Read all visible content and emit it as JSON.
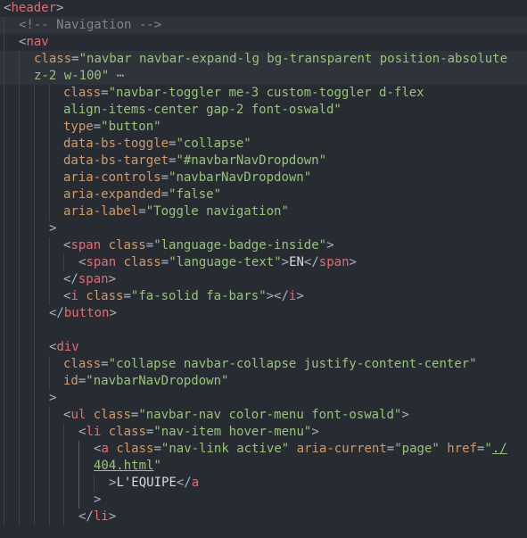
{
  "editor": {
    "language": "html",
    "colors": {
      "background": "#272c33",
      "tag": "#e06c75",
      "attribute": "#d19a66",
      "string": "#98c379",
      "comment": "#7f848e",
      "text": "#d7dae0"
    },
    "lines": [
      {
        "highlight": false,
        "tokens": [
          {
            "t": "pun",
            "v": "<"
          },
          {
            "t": "tag",
            "v": "header"
          },
          {
            "t": "pun",
            "v": ">"
          }
        ]
      },
      {
        "highlight": true,
        "tokens": [
          {
            "t": "com",
            "v": "<!-- Navigation -->"
          }
        ]
      },
      {
        "highlight": false,
        "tokens": [
          {
            "t": "pun",
            "v": "<"
          },
          {
            "t": "tag",
            "v": "nav"
          }
        ]
      },
      {
        "highlight": true,
        "tokens": [
          {
            "t": "attr",
            "v": "class"
          },
          {
            "t": "pun",
            "v": "="
          },
          {
            "t": "str",
            "v": "\"navbar navbar-expand-lg bg-transparent position-absolute"
          }
        ]
      },
      {
        "highlight": true,
        "tokens": [
          {
            "t": "str",
            "v": "z-2 w-100\""
          },
          {
            "t": "fold",
            "v": " ⋯"
          }
        ]
      },
      {
        "highlight": false,
        "tokens": [
          {
            "t": "attr",
            "v": "class"
          },
          {
            "t": "pun",
            "v": "="
          },
          {
            "t": "str",
            "v": "\"navbar-toggler me-3 custom-toggler d-flex"
          }
        ]
      },
      {
        "highlight": false,
        "tokens": [
          {
            "t": "str",
            "v": "align-items-center gap-2 font-oswald\""
          }
        ]
      },
      {
        "highlight": false,
        "tokens": [
          {
            "t": "attr",
            "v": "type"
          },
          {
            "t": "pun",
            "v": "="
          },
          {
            "t": "str",
            "v": "\"button\""
          }
        ]
      },
      {
        "highlight": false,
        "tokens": [
          {
            "t": "attr",
            "v": "data-bs-toggle"
          },
          {
            "t": "pun",
            "v": "="
          },
          {
            "t": "str",
            "v": "\"collapse\""
          }
        ]
      },
      {
        "highlight": false,
        "tokens": [
          {
            "t": "attr",
            "v": "data-bs-target"
          },
          {
            "t": "pun",
            "v": "="
          },
          {
            "t": "str",
            "v": "\"#navbarNavDropdown\""
          }
        ]
      },
      {
        "highlight": false,
        "tokens": [
          {
            "t": "attr",
            "v": "aria-controls"
          },
          {
            "t": "pun",
            "v": "="
          },
          {
            "t": "str",
            "v": "\"navbarNavDropdown\""
          }
        ]
      },
      {
        "highlight": false,
        "tokens": [
          {
            "t": "attr",
            "v": "aria-expanded"
          },
          {
            "t": "pun",
            "v": "="
          },
          {
            "t": "str",
            "v": "\"false\""
          }
        ]
      },
      {
        "highlight": false,
        "tokens": [
          {
            "t": "attr",
            "v": "aria-label"
          },
          {
            "t": "pun",
            "v": "="
          },
          {
            "t": "str",
            "v": "\"Toggle navigation\""
          }
        ]
      },
      {
        "highlight": false,
        "tokens": [
          {
            "t": "pun",
            "v": ">"
          }
        ]
      },
      {
        "highlight": false,
        "tokens": [
          {
            "t": "pun",
            "v": "<"
          },
          {
            "t": "tag",
            "v": "span"
          },
          {
            "t": "txt",
            "v": " "
          },
          {
            "t": "attr",
            "v": "class"
          },
          {
            "t": "pun",
            "v": "="
          },
          {
            "t": "str",
            "v": "\"language-badge-inside\""
          },
          {
            "t": "pun",
            "v": ">"
          }
        ]
      },
      {
        "highlight": false,
        "tokens": [
          {
            "t": "pun",
            "v": "<"
          },
          {
            "t": "tag",
            "v": "span"
          },
          {
            "t": "txt",
            "v": " "
          },
          {
            "t": "attr",
            "v": "class"
          },
          {
            "t": "pun",
            "v": "="
          },
          {
            "t": "str",
            "v": "\"language-text\""
          },
          {
            "t": "pun",
            "v": ">"
          },
          {
            "t": "txt",
            "v": "EN"
          },
          {
            "t": "pun",
            "v": "</"
          },
          {
            "t": "tag",
            "v": "span"
          },
          {
            "t": "pun",
            "v": ">"
          }
        ]
      },
      {
        "highlight": false,
        "tokens": [
          {
            "t": "pun",
            "v": "</"
          },
          {
            "t": "tag",
            "v": "span"
          },
          {
            "t": "pun",
            "v": ">"
          }
        ]
      },
      {
        "highlight": false,
        "tokens": [
          {
            "t": "pun",
            "v": "<"
          },
          {
            "t": "tag",
            "v": "i"
          },
          {
            "t": "txt",
            "v": " "
          },
          {
            "t": "attr",
            "v": "class"
          },
          {
            "t": "pun",
            "v": "="
          },
          {
            "t": "str",
            "v": "\"fa-solid fa-bars\""
          },
          {
            "t": "pun",
            "v": "></"
          },
          {
            "t": "tag",
            "v": "i"
          },
          {
            "t": "pun",
            "v": ">"
          }
        ]
      },
      {
        "highlight": false,
        "tokens": [
          {
            "t": "pun",
            "v": "</"
          },
          {
            "t": "tag",
            "v": "button"
          },
          {
            "t": "pun",
            "v": ">"
          }
        ]
      },
      {
        "highlight": false,
        "tokens": []
      },
      {
        "highlight": false,
        "tokens": [
          {
            "t": "pun",
            "v": "<"
          },
          {
            "t": "tag",
            "v": "div"
          }
        ]
      },
      {
        "highlight": false,
        "tokens": [
          {
            "t": "attr",
            "v": "class"
          },
          {
            "t": "pun",
            "v": "="
          },
          {
            "t": "str",
            "v": "\"collapse navbar-collapse justify-content-center\""
          }
        ]
      },
      {
        "highlight": false,
        "tokens": [
          {
            "t": "attr",
            "v": "id"
          },
          {
            "t": "pun",
            "v": "="
          },
          {
            "t": "str",
            "v": "\"navbarNavDropdown\""
          }
        ]
      },
      {
        "highlight": false,
        "tokens": [
          {
            "t": "pun",
            "v": ">"
          }
        ]
      },
      {
        "highlight": false,
        "tokens": [
          {
            "t": "pun",
            "v": "<"
          },
          {
            "t": "tag",
            "v": "ul"
          },
          {
            "t": "txt",
            "v": " "
          },
          {
            "t": "attr",
            "v": "class"
          },
          {
            "t": "pun",
            "v": "="
          },
          {
            "t": "str",
            "v": "\"navbar-nav color-menu font-oswald\""
          },
          {
            "t": "pun",
            "v": ">"
          }
        ]
      },
      {
        "highlight": false,
        "tokens": [
          {
            "t": "pun",
            "v": "<"
          },
          {
            "t": "tag",
            "v": "li"
          },
          {
            "t": "txt",
            "v": " "
          },
          {
            "t": "attr",
            "v": "class"
          },
          {
            "t": "pun",
            "v": "="
          },
          {
            "t": "str",
            "v": "\"nav-item hover-menu\""
          },
          {
            "t": "pun",
            "v": ">"
          }
        ]
      },
      {
        "highlight": false,
        "tokens": [
          {
            "t": "pun",
            "v": "<"
          },
          {
            "t": "tag",
            "v": "a"
          },
          {
            "t": "txt",
            "v": " "
          },
          {
            "t": "attr",
            "v": "class"
          },
          {
            "t": "pun",
            "v": "="
          },
          {
            "t": "str",
            "v": "\"nav-link active\""
          },
          {
            "t": "txt",
            "v": " "
          },
          {
            "t": "attr",
            "v": "aria-current"
          },
          {
            "t": "pun",
            "v": "="
          },
          {
            "t": "str",
            "v": "\"page\""
          },
          {
            "t": "txt",
            "v": " "
          },
          {
            "t": "attr",
            "v": "href"
          },
          {
            "t": "pun",
            "v": "="
          },
          {
            "t": "str",
            "v": "\""
          },
          {
            "t": "strlink",
            "v": "./"
          }
        ]
      },
      {
        "highlight": false,
        "tokens": [
          {
            "t": "strlink",
            "v": "404.html"
          },
          {
            "t": "str",
            "v": "\""
          }
        ]
      },
      {
        "highlight": false,
        "tokens": [
          {
            "t": "pun",
            "v": ">"
          },
          {
            "t": "txt",
            "v": "L'EQUIPE"
          },
          {
            "t": "pun",
            "v": "</"
          },
          {
            "t": "tag",
            "v": "a"
          }
        ]
      },
      {
        "highlight": false,
        "tokens": [
          {
            "t": "pun",
            "v": ">"
          }
        ]
      },
      {
        "highlight": false,
        "tokens": [
          {
            "t": "pun",
            "v": "</"
          },
          {
            "t": "tag",
            "v": "li"
          },
          {
            "t": "pun",
            "v": ">"
          }
        ]
      }
    ]
  }
}
